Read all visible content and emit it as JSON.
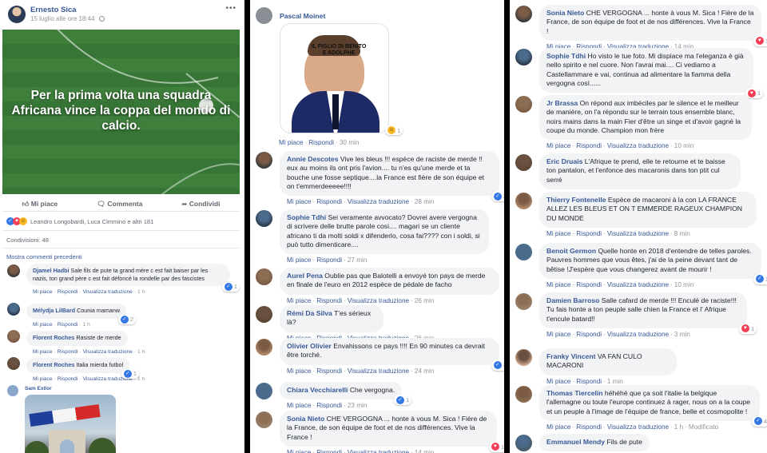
{
  "post": {
    "author": "Ernesto Sica",
    "date": "15 luglio alle ore 18:44",
    "privacy_icon": "globe-icon",
    "more": "•••",
    "image_text": "Per la prima volta una squadra Africana vince la coppa del mondo di calcio.",
    "actions": {
      "like": "Mi piace",
      "comment": "Commenta",
      "share": "Condividi"
    },
    "reactions_text": "Leandro Longobardi, Luca Cimmino e altri 181",
    "shares": "Condivisioni: 48",
    "previous": "Mostra commenti precedenti"
  },
  "labels": {
    "like": "Mi piace",
    "reply": "Rispondi",
    "translate": "Visualizza traduzione",
    "modified": "Modificato"
  },
  "col1": [
    {
      "name": "Djamel Hadbi",
      "text": "Sale fils de pute ta grand mère c est fait baiser par les nazis, ton grand père c est fait défoncé la rondelle par des fascistes",
      "time": "1 h",
      "translate": true,
      "react": "1"
    },
    {
      "name": "Mélydja LilBard",
      "text": "Counia mamanw",
      "time": "1 h",
      "translate": false,
      "react": "2"
    },
    {
      "name": "Florent Roches",
      "text": "Rasiste de merde",
      "time": "1 h",
      "translate": true,
      "react": ""
    },
    {
      "name": "Florent Roches",
      "text": "Italia mierda futbol",
      "time": "1 h",
      "translate": true,
      "react": "1"
    }
  ],
  "col1_last": {
    "name": "Sam Exilor"
  },
  "col2_top": {
    "name": "Pascal Moinet",
    "meme": "IL FIGLIO DI BENITO E ADOLPHE",
    "time": "30 min",
    "react": "1"
  },
  "col2": [
    {
      "name": "Annie Descotes",
      "text": "Vive les bleus !!! espèce de raciste de merde !! eux au moins ils ont pris l'avion.... tu n'es qu'une merde et ta bouche une fosse septique....la France est fière de son équipe et on t'emmerdeeeee!!!!",
      "time": "28 min",
      "translate": true,
      "react": "2"
    },
    {
      "name": "Sophie Tdhi",
      "text": "Sei veramente avvocato? Dovrei avere vergogna di scrivere delle brutte parole cosi.... magari se un cliente africano ti da molti soldi x difenderlo, cosa fai???? con i soldi, si può tutto dimenticare....",
      "time": "27 min",
      "translate": false,
      "react": ""
    },
    {
      "name": "Aurel Pena",
      "text": "Oublie pas que Balotelli a envoyé ton pays de merde en finale de l'euro en 2012 espèce de pédale de facho",
      "time": "26 min",
      "translate": true,
      "react": ""
    },
    {
      "name": "Rémi Da Silva",
      "text": "T'es sérieux là?",
      "time": "26 min",
      "translate": true,
      "react": ""
    },
    {
      "name": "Olivier Olivier",
      "text": "Envahissons ce pays !!!! En 90 minutes ca devrait être torché.",
      "time": "24 min",
      "translate": true,
      "react": "3"
    },
    {
      "name": "Chiara Vecchiarelli",
      "text": "Che vergogna.",
      "time": "23 min",
      "translate": false,
      "react": "1"
    },
    {
      "name": "Sonia Nieto",
      "text": "CHE VERGOGNA ... honte à vous M. Sica ! Fière de la France, de son équipe de foot et de nos différences. Vive la France !",
      "time": "14 min",
      "translate": true,
      "react": "1"
    }
  ],
  "col3": [
    {
      "name": "Sonia Nieto",
      "text": "CHE VERGOGNA ... honte à vous M. Sica ! Fière de la France, de son équipe de foot et de nos différences. Vive la France !",
      "time": "14 min",
      "translate": true,
      "react": "1",
      "modified": false
    },
    {
      "name": "Sophie Tdhi",
      "text": "Ho visto le tue foto. Mi dispiace ma l'eleganza è già nello spirito e nel cuore. Non l'avrai mai.... Ci vediamo a Castellammare e vai, continua ad alimentare la fiamma della vergogna così......",
      "time": "8 min",
      "translate": false,
      "react": "1",
      "modified": true
    },
    {
      "name": "Jr Brassa",
      "text": "On répond aux imbéciles par le silence et le meilleur de manière, on l'a répondu sur le terrain tous ensemble blanc, noirs mains dans la main Fier d'être un singe et d'avoir gagné la coupe du monde. Champion mon frère",
      "time": "10 min",
      "translate": true,
      "react": "",
      "modified": false
    },
    {
      "name": "Eric Druais",
      "text": "L'Afrique te prend, elle te retourne et te baisse ton pantalon, et l'enfonce des macaronis dans ton ptit cul serré",
      "time": "10 min",
      "translate": true,
      "react": "",
      "modified": false
    },
    {
      "name": "Thierry Fontenelle",
      "text": "Espèce de macaroni à la con LA FRANCE ALLEZ LES BLEUS ET ON T EMMERDE RAGEUX CHAMPION DU MONDE",
      "time": "8 min",
      "translate": true,
      "react": "",
      "modified": false
    },
    {
      "name": "Benoit Germon",
      "text": "Quelle honte en 2018 d'entendre de telles paroles. Pauvres hommes que vous êtes, j'ai de la peine devant tant de bêtise !J'espère que vous changerez avant de mourir !",
      "time": "10 min",
      "translate": true,
      "react": "1",
      "modified": false
    },
    {
      "name": "Damien Barroso",
      "text": "Salle cafard de merde !!! Enculé de raciste!!! Tu fais honte a ton peuple salle chien la France et l' Afrique t'encule batard!!",
      "time": "3 min",
      "translate": true,
      "react": "1",
      "modified": false
    },
    {
      "name": "Franky Vincent",
      "text": "VA FAN CULO MACARONI",
      "time": "1 min",
      "translate": false,
      "react": "",
      "modified": false
    },
    {
      "name": "Thomas Tiercelin",
      "text": "héhéhé que ça soit l'italie la belgique l'allemagne ou toute l'europe continuez à rager, nous on a la coupe et un peuple à l'image de l'équipe de france, belle et cosmopolite !",
      "time": "1 h",
      "translate": true,
      "react": "4",
      "modified": true
    },
    {
      "name": "Emmanuel Mendy",
      "text": "Fils de pute",
      "time": "",
      "translate": false,
      "react": "",
      "modified": false
    }
  ],
  "colors": {
    "link": "#385898",
    "bubble": "#f2f3f5",
    "like": "#3578e5",
    "heart": "#f33e58",
    "grass": "#3c7a3a"
  }
}
